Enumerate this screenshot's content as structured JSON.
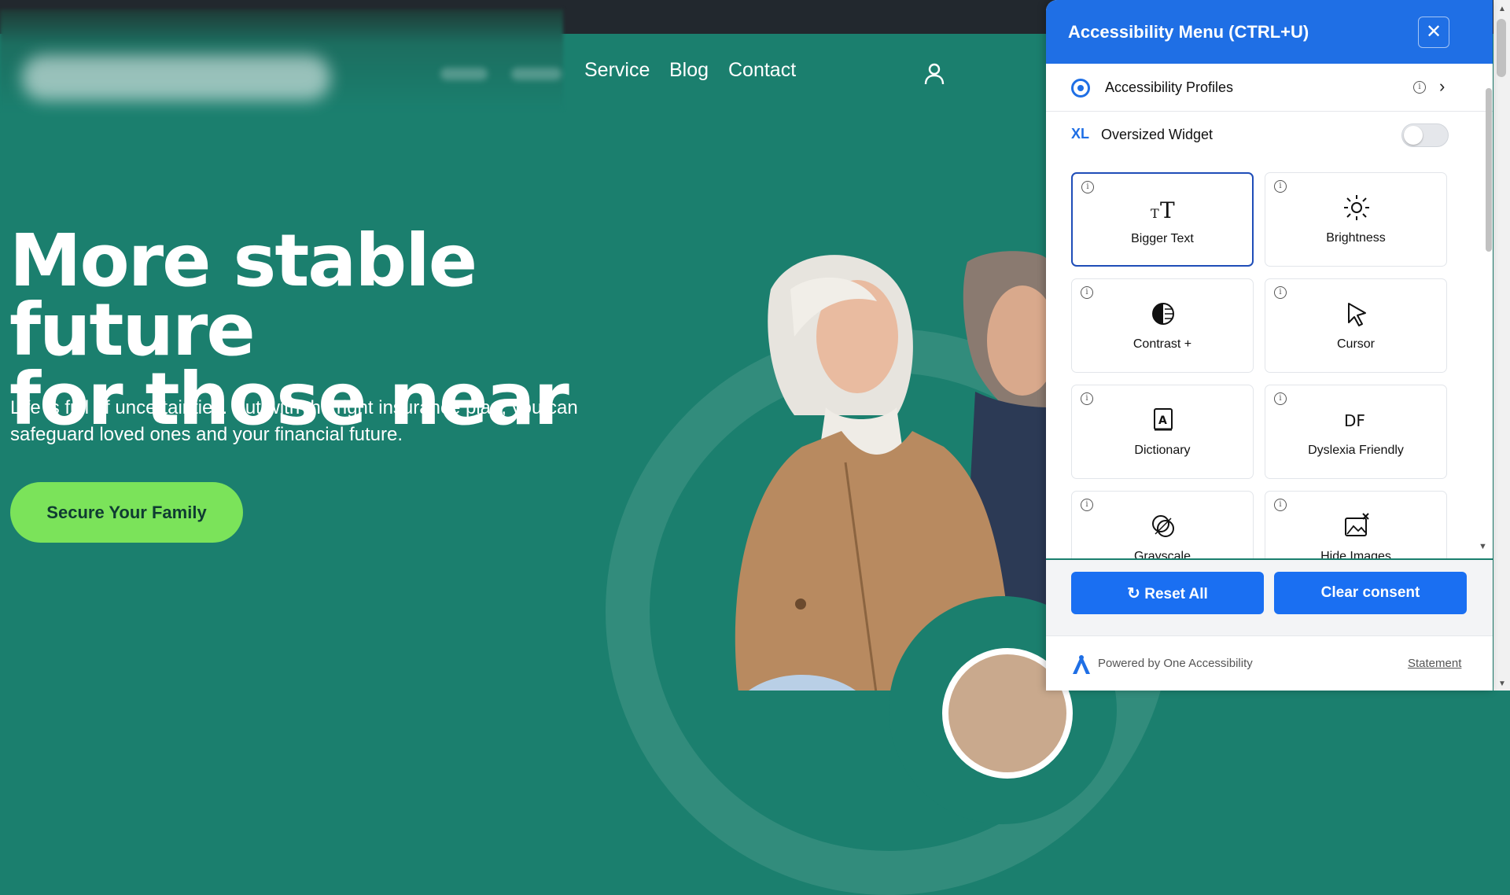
{
  "nav": {
    "links": [
      "Service",
      "Blog",
      "Contact"
    ]
  },
  "hero": {
    "title_line1": "More stable future",
    "title_line2": "for those near",
    "subtitle_line1": "Life is full of uncertainties. But with the right insurance plan, you can",
    "subtitle_line2": "safeguard loved ones and your financial future.",
    "cta_label": "Secure Your Family"
  },
  "a11y_panel": {
    "title": "Accessibility Menu (CTRL+U)",
    "close_glyph": "✕",
    "profiles_label": "Accessibility Profiles",
    "oversized_badge": "XL",
    "oversized_label": "Oversized Widget",
    "oversized_enabled": false,
    "tiles": [
      {
        "label": "Bigger Text",
        "icon": "bigger-text-icon",
        "active": true
      },
      {
        "label": "Brightness",
        "icon": "brightness-icon",
        "active": false
      },
      {
        "label": "Contrast +",
        "icon": "contrast-icon",
        "active": false
      },
      {
        "label": "Cursor",
        "icon": "cursor-icon",
        "active": false
      },
      {
        "label": "Dictionary",
        "icon": "dictionary-icon",
        "active": false
      },
      {
        "label": "Dyslexia Friendly",
        "icon": "dyslexia-icon",
        "active": false
      },
      {
        "label": "Grayscale",
        "icon": "grayscale-icon",
        "active": false
      },
      {
        "label": "Hide Images",
        "icon": "hide-images-icon",
        "active": false
      }
    ],
    "dyslexia_glyph": "DF",
    "reset_label": "Reset All",
    "clear_label": "Clear consent",
    "powered_by": "Powered by One Accessibility",
    "statement": "Statement"
  },
  "colors": {
    "hero_bg": "#1b7f6e",
    "cta_bg": "#7be35a",
    "panel_header": "#1f6fe5",
    "button_blue": "#1a6ff2"
  }
}
